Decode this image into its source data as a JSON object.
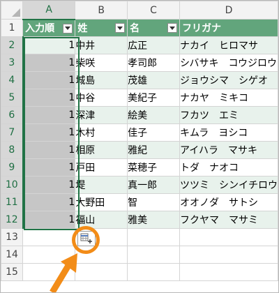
{
  "sheet": {
    "columns": [
      "A",
      "B",
      "C",
      "D"
    ],
    "active_column": "A",
    "row_numbers": [
      "1",
      "2",
      "3",
      "4",
      "5",
      "6",
      "7",
      "8",
      "9",
      "10",
      "11",
      "12",
      "13",
      "14",
      "15"
    ],
    "table_headers": [
      "入力順",
      "姓",
      "名",
      "フリガナ"
    ],
    "rows": [
      {
        "order": "1",
        "last": "中井",
        "first": "広正",
        "kana": "ナカイ　ヒロマサ"
      },
      {
        "order": "1",
        "last": "柴咲",
        "first": "孝司郎",
        "kana": "シバサキ　コウジロウ"
      },
      {
        "order": "1",
        "last": "城島",
        "first": "茂雄",
        "kana": "ジョウシマ　シゲオ"
      },
      {
        "order": "1",
        "last": "中谷",
        "first": "美紀子",
        "kana": "ナカヤ　ミキコ"
      },
      {
        "order": "1",
        "last": "深津",
        "first": "絵美",
        "kana": "フカツ　エミ"
      },
      {
        "order": "1",
        "last": "木村",
        "first": "佳子",
        "kana": "キムラ　ヨシコ"
      },
      {
        "order": "1",
        "last": "相原",
        "first": "雅紀",
        "kana": "アイハラ　マサキ"
      },
      {
        "order": "1",
        "last": "戸田",
        "first": "菜穂子",
        "kana": "トダ　ナオコ"
      },
      {
        "order": "1",
        "last": "堤",
        "first": "真一郎",
        "kana": "ツツミ　シンイチロウ"
      },
      {
        "order": "1",
        "last": "大野田",
        "first": "智",
        "kana": "オオノダ　サトシ"
      },
      {
        "order": "1",
        "last": "福山",
        "first": "雅美",
        "kana": "フクヤマ　マサミ"
      }
    ]
  },
  "colors": {
    "header_green": "#62a57c",
    "band_light": "#e8f2ec",
    "selection_border": "#217346",
    "highlight_orange": "#f28c18"
  },
  "overlay": {
    "auto_fill_options_icon": "auto-fill-options-icon",
    "highlight_icon": "circle-highlight",
    "arrow_icon": "arrow-pointer-icon"
  }
}
